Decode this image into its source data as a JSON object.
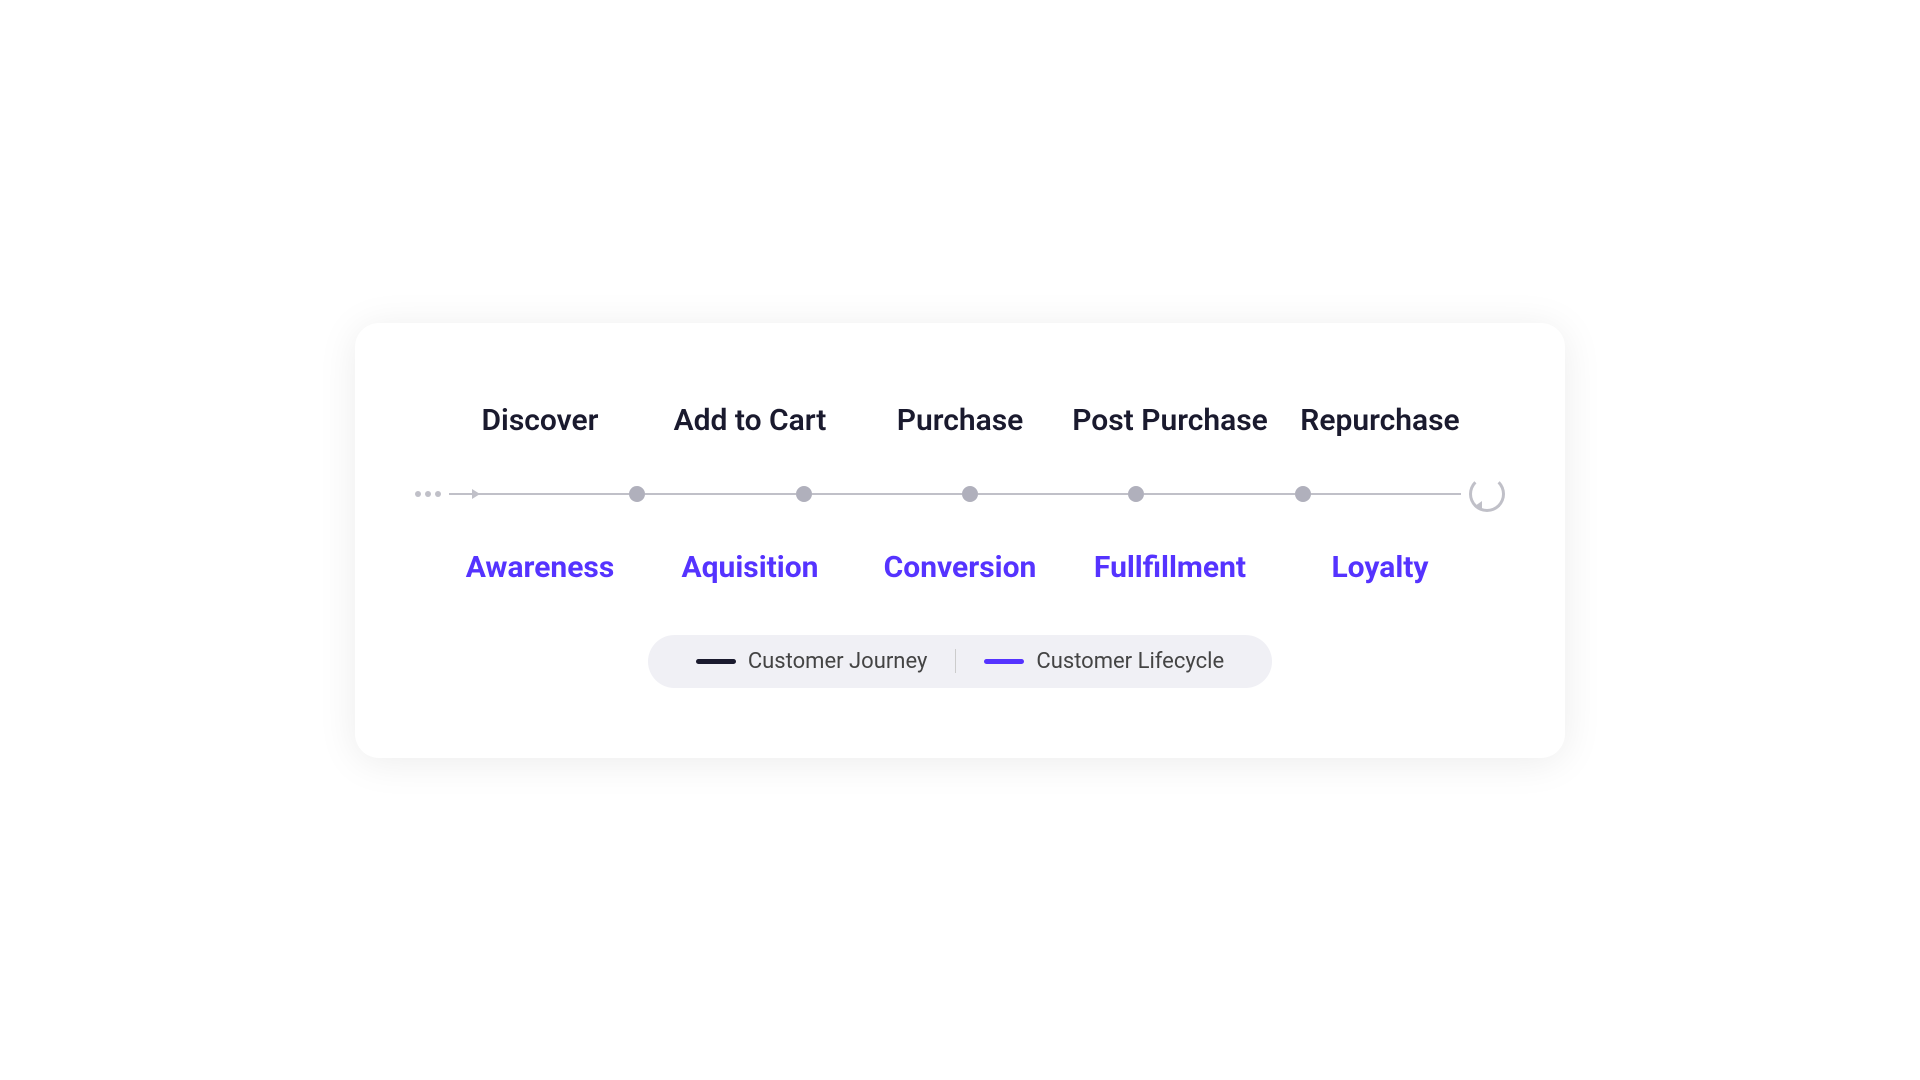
{
  "card": {
    "stages": [
      {
        "top_label": "Discover",
        "bottom_label": "Awareness"
      },
      {
        "top_label": "Add to Cart",
        "bottom_label": "Aquisition"
      },
      {
        "top_label": "Purchase",
        "bottom_label": "Conversion"
      },
      {
        "top_label": "Post Purchase",
        "bottom_label": "Fullfillment"
      },
      {
        "top_label": "Repurchase",
        "bottom_label": "Loyalty"
      }
    ],
    "legend": [
      {
        "id": "customer-journey",
        "line_type": "dark",
        "label": "Customer Journey"
      },
      {
        "id": "customer-lifecycle",
        "line_type": "purple",
        "label": "Customer Lifecycle"
      }
    ]
  }
}
